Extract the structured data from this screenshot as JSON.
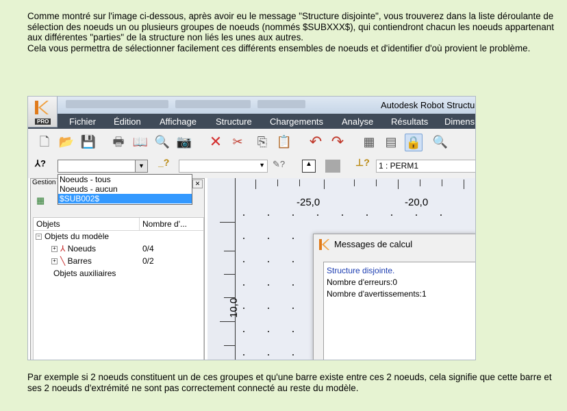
{
  "intro": {
    "line1": "Comme montré sur l'image ci-dessous, après avoir eu le message \"Structure disjointe\", vous trouverez dans la liste déroulante de sélection des noeuds un ou plusieurs groupes de noeuds (nommés $SUBXXX$), qui contiendront chacun les noeuds appartenant aux différentes \"parties\" de la structure non liés les unes aux autres.",
    "line2": "Cela vous permettra de sélectionner facilement ces différents ensembles de noeuds et d'identifier d'où provient le problème."
  },
  "outro": "Par exemple si 2 noeuds constituent un de ces groupes et qu'une barre existe entre ces 2 noeuds, cela signifie que cette barre et ses 2 noeuds d'extrémité ne sont pas correctement connecté au reste du modèle.",
  "app": {
    "title": "Autodesk Robot Structu",
    "logo_badge": "PRO",
    "menu": [
      "Fichier",
      "Édition",
      "Affichage",
      "Structure",
      "Chargements",
      "Analyse",
      "Résultats",
      "Dimensi"
    ],
    "toolbar_icons": [
      "new-file-icon",
      "open-folder-icon",
      "save-icon",
      "print-icon",
      "book-icon",
      "preview-icon",
      "camera-icon",
      "delete-icon",
      "cut-icon",
      "copy-icon",
      "paste-icon",
      "undo-icon",
      "redo-icon",
      "calculator-icon",
      "table-icon",
      "lock-icon",
      "zoom-icon"
    ],
    "node_selector": {
      "value": "",
      "options": [
        "Noeuds - tous",
        "Noeuds - aucun",
        "$SUB002$"
      ],
      "selected_index": 2
    },
    "case_selector": {
      "value": "1 : PERM1"
    },
    "toolbar2_labels": {
      "node_q": "?",
      "bar_q": "?",
      "cases_q": "?"
    },
    "panel": {
      "header": "Gestion",
      "columns": [
        "Objets",
        "Nombre d'..."
      ],
      "tree": [
        {
          "label": "Objets du modèle",
          "count": ""
        },
        {
          "label": "Noeuds",
          "count": "0/4"
        },
        {
          "label": "Barres",
          "count": "0/2"
        },
        {
          "label": "Objets auxiliaires",
          "count": ""
        }
      ]
    },
    "canvas": {
      "x_labels": [
        "-25,0",
        "-20,0"
      ],
      "y_label": "10,0"
    },
    "message_dialog": {
      "title": "Messages de calcul",
      "lines": [
        "Structure disjointe.",
        "Nombre d'erreurs:0",
        "Nombre d'avertissements:1"
      ]
    }
  }
}
